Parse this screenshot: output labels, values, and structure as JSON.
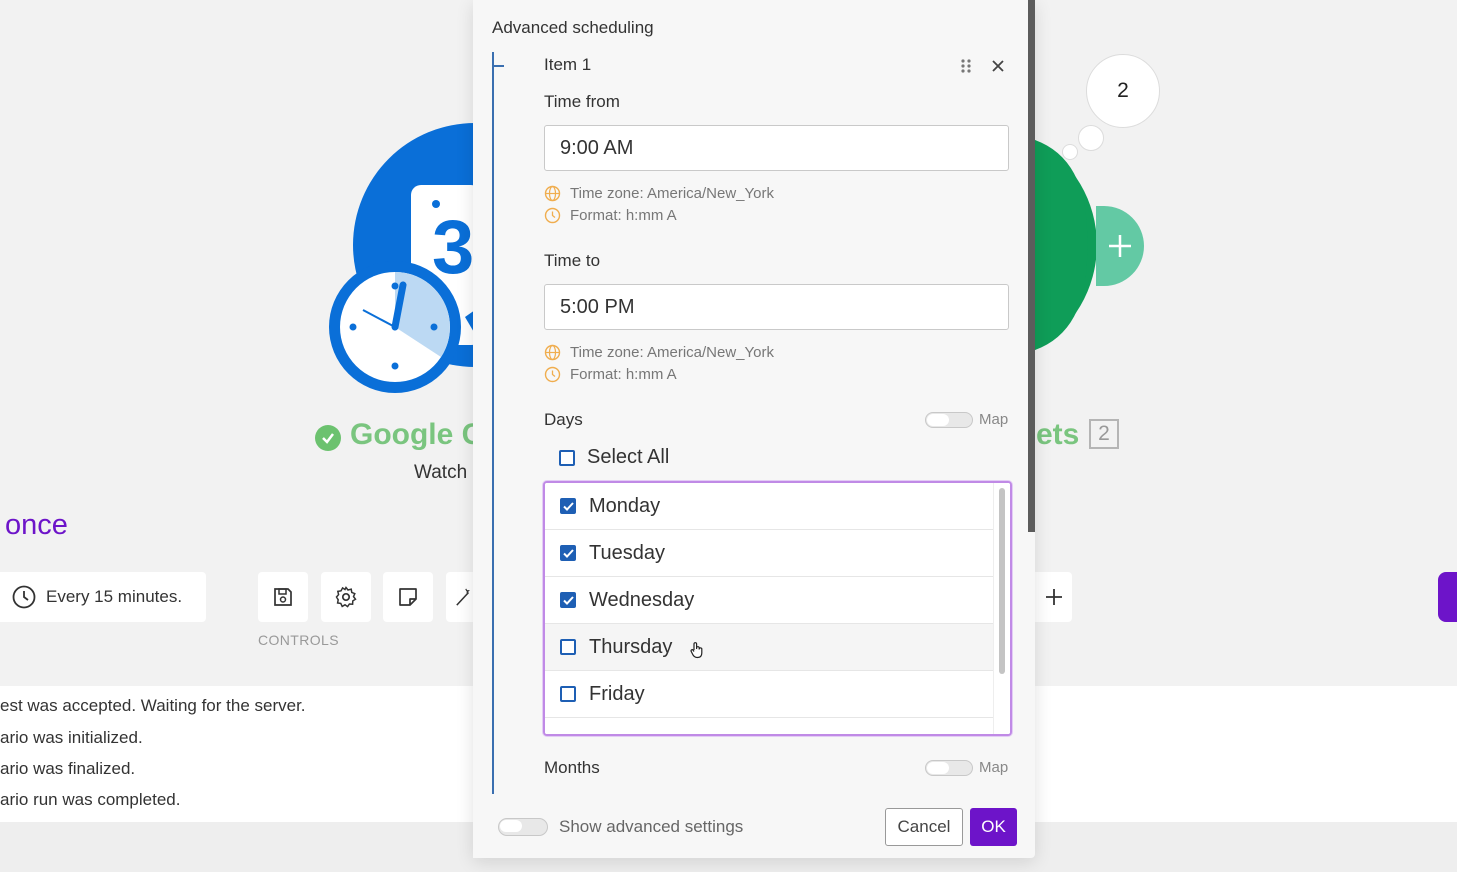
{
  "background": {
    "left_module": {
      "name": "Google C",
      "subtitle": "Watch"
    },
    "right_module": {
      "name": "ets",
      "badge": "2"
    },
    "bubble_count": "2",
    "run_once_label": "once",
    "schedule_label": "Every 15 minutes.",
    "controls_label": "CONTROLS",
    "log_lines": [
      "est was accepted. Waiting for the server.",
      "ario was initialized.",
      "ario was finalized.",
      "ario run was completed."
    ],
    "calendar_digit": "3"
  },
  "dialog": {
    "title": "Advanced scheduling",
    "item": {
      "title": "Item 1",
      "time_from": {
        "label": "Time from",
        "value": "9:00 AM",
        "timezone_hint": "Time zone: America/New_York",
        "format_hint": "Format: h:mm A"
      },
      "time_to": {
        "label": "Time to",
        "value": "5:00 PM",
        "timezone_hint": "Time zone: America/New_York",
        "format_hint": "Format: h:mm A"
      },
      "days": {
        "label": "Days",
        "map_label": "Map",
        "select_all_label": "Select All",
        "select_all_checked": false,
        "options": [
          {
            "label": "Monday",
            "checked": true
          },
          {
            "label": "Tuesday",
            "checked": true
          },
          {
            "label": "Wednesday",
            "checked": true
          },
          {
            "label": "Thursday",
            "checked": false
          },
          {
            "label": "Friday",
            "checked": false
          }
        ]
      },
      "months": {
        "label": "Months",
        "map_label": "Map"
      }
    },
    "footer": {
      "advanced_toggle_label": "Show advanced settings",
      "cancel_label": "Cancel",
      "ok_label": "OK"
    }
  },
  "colors": {
    "accent_purple": "#6d14c9",
    "checkbox_blue": "#1e5fb4",
    "hint_icon_orange": "#f0ad4e",
    "module_green_text": "#7ac57f",
    "calendar_blue": "#0a6fd8",
    "sheets_green": "#0f9d58"
  },
  "icons": {
    "hint_timezone": "globe-icon",
    "hint_format": "clock-icon",
    "drag": "drag-handle-icon",
    "close": "close-icon",
    "check": "checkmark-icon"
  }
}
